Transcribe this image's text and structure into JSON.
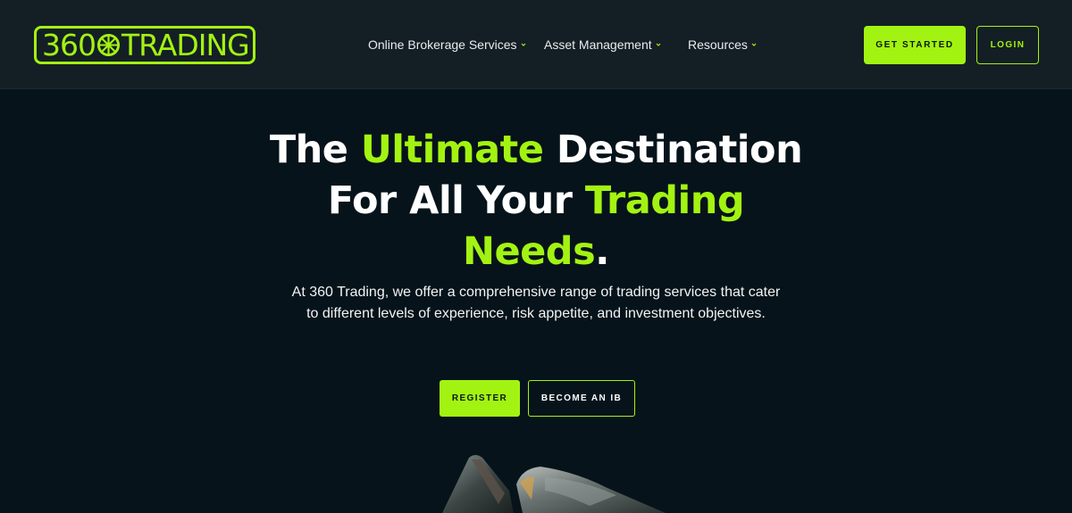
{
  "brand": {
    "logo_left": "360",
    "logo_right": "TRADING",
    "accent_color": "#a3f312",
    "background_color": "#06131a",
    "header_color": "#141f25"
  },
  "nav": {
    "items": [
      {
        "label": "Online Brokerage Services",
        "icon": "chevron-down-icon"
      },
      {
        "label": "Asset Management",
        "icon": "chevron-down-icon"
      },
      {
        "label": "Resources",
        "icon": "chevron-down-icon"
      }
    ]
  },
  "header_actions": {
    "get_started": "GET STARTED",
    "login": "LOGIN"
  },
  "hero": {
    "title_part1": "The ",
    "title_accent1": "Ultimate",
    "title_part2": " Destination",
    "title_part3": "For All Your ",
    "title_accent2": "Trading",
    "title_accent3": "Needs",
    "title_end": ".",
    "description_line1": "At 360 Trading, we offer a comprehensive range of trading services that cater",
    "description_line2": "to different levels of experience, risk appetite, and investment objectives.",
    "register": "REGISTER",
    "become_ib": "BECOME AN IB"
  }
}
